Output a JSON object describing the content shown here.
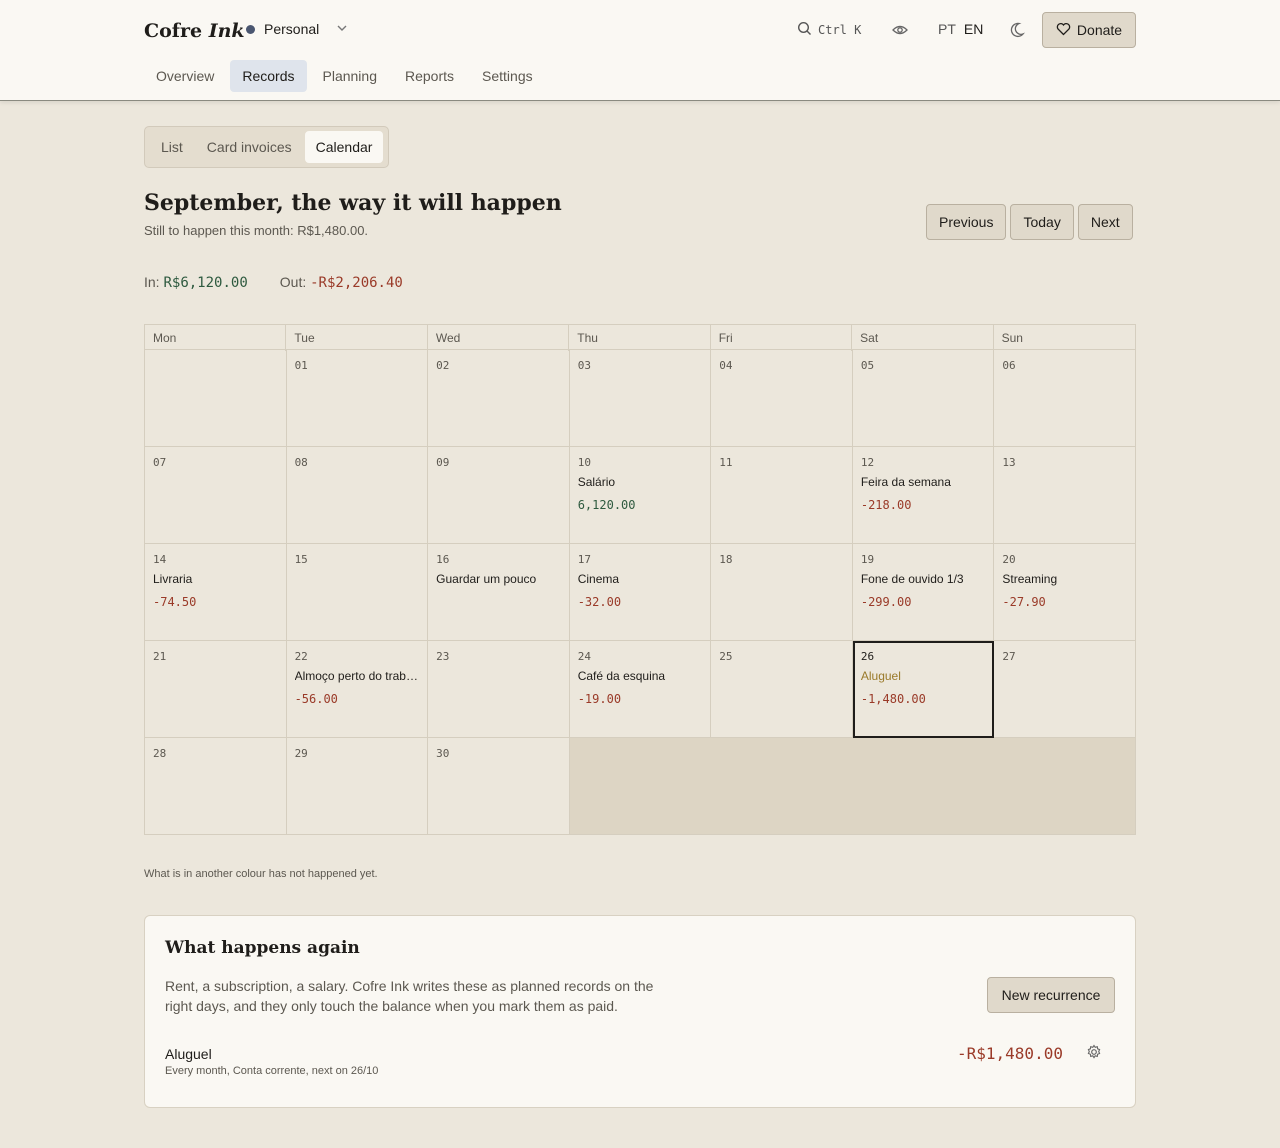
{
  "header": {
    "brand_main": "Cofre",
    "brand_italic": "Ink",
    "profile_label": "Personal",
    "search_shortcut": "Ctrl K",
    "lang_pt": "PT",
    "lang_en": "EN",
    "donate_label": "Donate"
  },
  "nav": {
    "items": [
      {
        "label": "Overview"
      },
      {
        "label": "Records"
      },
      {
        "label": "Planning"
      },
      {
        "label": "Reports"
      },
      {
        "label": "Settings"
      }
    ]
  },
  "subtabs": {
    "list": "List",
    "card_invoices": "Card invoices",
    "calendar": "Calendar"
  },
  "page": {
    "title": "September, the way it will happen",
    "subtitle": "Still to happen this month: R$1,480.00.",
    "prev": "Previous",
    "today": "Today",
    "next": "Next",
    "in_label": "In:",
    "in_value": "R$6,120.00",
    "out_label": "Out:",
    "out_value": "-R$2,206.40"
  },
  "calendar": {
    "weekdays": [
      "Mon",
      "Tue",
      "Wed",
      "Thu",
      "Fri",
      "Sat",
      "Sun"
    ],
    "days": [
      {
        "d": ""
      },
      {
        "d": "01"
      },
      {
        "d": "02"
      },
      {
        "d": "03"
      },
      {
        "d": "04"
      },
      {
        "d": "05"
      },
      {
        "d": "06"
      },
      {
        "d": "07"
      },
      {
        "d": "08"
      },
      {
        "d": "09"
      },
      {
        "d": "10",
        "ev": "Salário",
        "amt": "6,120.00",
        "sign": "pos"
      },
      {
        "d": "11"
      },
      {
        "d": "12",
        "ev": "Feira da semana",
        "amt": "-218.00",
        "sign": "neg"
      },
      {
        "d": "13"
      },
      {
        "d": "14",
        "ev": "Livraria",
        "amt": "-74.50",
        "sign": "neg"
      },
      {
        "d": "15"
      },
      {
        "d": "16",
        "ev": "Guardar um pouco"
      },
      {
        "d": "17",
        "ev": "Cinema",
        "amt": "-32.00",
        "sign": "neg"
      },
      {
        "d": "18"
      },
      {
        "d": "19",
        "ev": "Fone de ouvido 1/3",
        "amt": "-299.00",
        "sign": "neg"
      },
      {
        "d": "20",
        "ev": "Streaming",
        "amt": "-27.90",
        "sign": "neg"
      },
      {
        "d": "21"
      },
      {
        "d": "22",
        "ev": "Almoço perto do trab…",
        "amt": "-56.00",
        "sign": "neg"
      },
      {
        "d": "23"
      },
      {
        "d": "24",
        "ev": "Café da esquina",
        "amt": "-19.00",
        "sign": "neg"
      },
      {
        "d": "25"
      },
      {
        "d": "26",
        "ev": "Aluguel",
        "amt": "-1,480.00",
        "sign": "neg",
        "today": true
      },
      {
        "d": "27"
      },
      {
        "d": "28"
      },
      {
        "d": "29"
      },
      {
        "d": "30"
      }
    ],
    "footnote": "What is in another colour has not happened yet."
  },
  "recurrence": {
    "title": "What happens again",
    "text": "Rent, a subscription, a salary. Cofre Ink writes these as planned records on the right days, and they only touch the balance when you mark them as paid.",
    "new_button": "New recurrence",
    "item_name": "Aluguel",
    "item_meta": "Every month, Conta corrente, next on 26/10",
    "item_amount": "-R$1,480.00"
  },
  "colors": {
    "background": "#ece7dc",
    "header": "#faf8f3",
    "income": "#2e5a3f",
    "expense": "#9a3a28",
    "active_nav": "#dfe4ec"
  }
}
